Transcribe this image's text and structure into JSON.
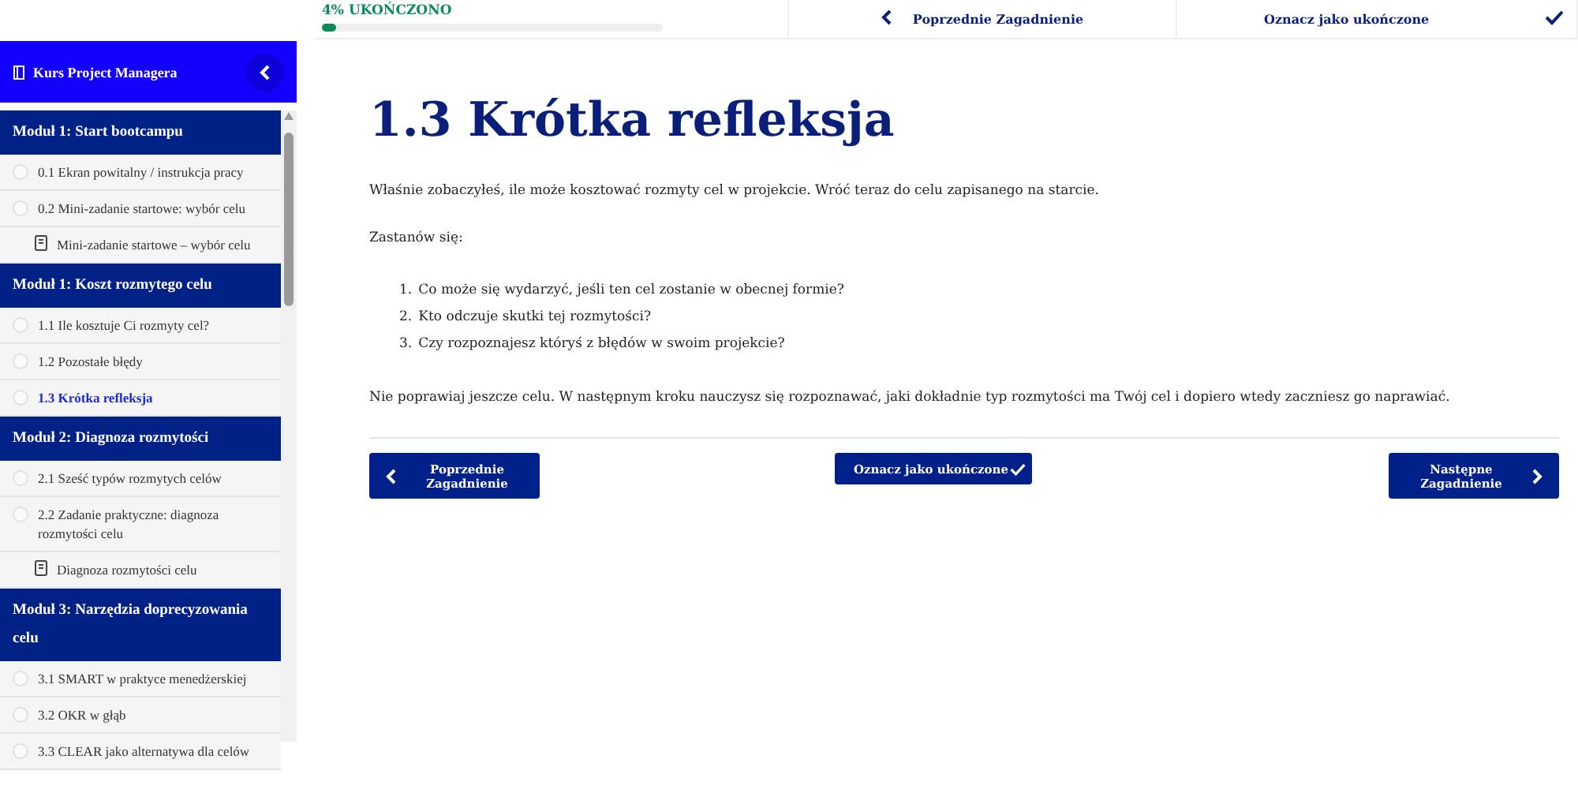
{
  "top_bar": {
    "progress": {
      "label": "4% UKOŃCZONO",
      "level": 0.04
    },
    "prev_button": "Poprzednie Zagadnienie",
    "complete_button": "Oznacz jako ukończone"
  },
  "sidebar": {
    "title": "Kurs Project Managera",
    "modules": [
      {
        "title": "Moduł 1: Start bootcampu",
        "items": [
          {
            "kind": "lesson",
            "label": "0.1 Ekran powitalny / instrukcja pracy",
            "selected": false
          },
          {
            "kind": "lesson",
            "label": "0.2 Mini-zadanie startowe: wybór celu",
            "selected": false
          },
          {
            "kind": "task",
            "label": "Mini-zadanie startowe – wybór celu",
            "selected": false
          }
        ]
      },
      {
        "title": "Moduł 1: Koszt rozmytego celu",
        "items": [
          {
            "kind": "lesson",
            "label": "1.1 Ile kosztuje Ci rozmyty cel?",
            "selected": false
          },
          {
            "kind": "lesson",
            "label": "1.2 Pozostałe błędy",
            "selected": false
          },
          {
            "kind": "lesson",
            "label": "1.3 Krótka refleksja",
            "selected": true
          }
        ]
      },
      {
        "title": "Moduł 2: Diagnoza rozmytości",
        "items": [
          {
            "kind": "lesson",
            "label": "2.1 Sześć typów rozmytych celów",
            "selected": false
          },
          {
            "kind": "lesson",
            "label": "2.2 Zadanie praktyczne: diagnoza rozmytości celu",
            "selected": false
          },
          {
            "kind": "task",
            "label": "Diagnoza rozmytości celu",
            "selected": false
          }
        ]
      },
      {
        "title": "Moduł 3: Narzędzia doprecyzowania celu",
        "items": [
          {
            "kind": "lesson",
            "label": "3.1 SMART w praktyce menedżerskiej",
            "selected": false
          },
          {
            "kind": "lesson",
            "label": "3.2 OKR w głąb",
            "selected": false
          },
          {
            "kind": "lesson",
            "label": "3.3 CLEAR jako alternatywa dla celów",
            "selected": false
          }
        ]
      }
    ]
  },
  "lesson": {
    "title": "1.3 Krótka refleksja",
    "intro": "Właśnie zobaczyłeś, ile może kosztować rozmyty cel w projekcie. Wróć teraz do celu zapisanego na starcie.",
    "prompt": "Zastanów się:",
    "questions": [
      {
        "number": "1.",
        "text": "Co może się wydarzyć, jeśli ten cel zostanie w obecnej formie?"
      },
      {
        "number": "2.",
        "text": "Kto odczuje skutki tej rozmytości?"
      },
      {
        "number": "3.",
        "text": "Czy rozpoznajesz któryś z błędów w swoim projekcie?"
      }
    ],
    "outro": "Nie poprawiaj jeszcze celu. W następnym kroku nauczysz się rozpoznawać, jaki dokładnie typ rozmytości ma Twój cel i dopiero wtedy zaczniesz go naprawiać."
  },
  "footer_buttons": {
    "prev": "Poprzednie Zagadnienie",
    "complete": "Oznacz jako ukończone",
    "next": "Następne Zagadnienie"
  }
}
